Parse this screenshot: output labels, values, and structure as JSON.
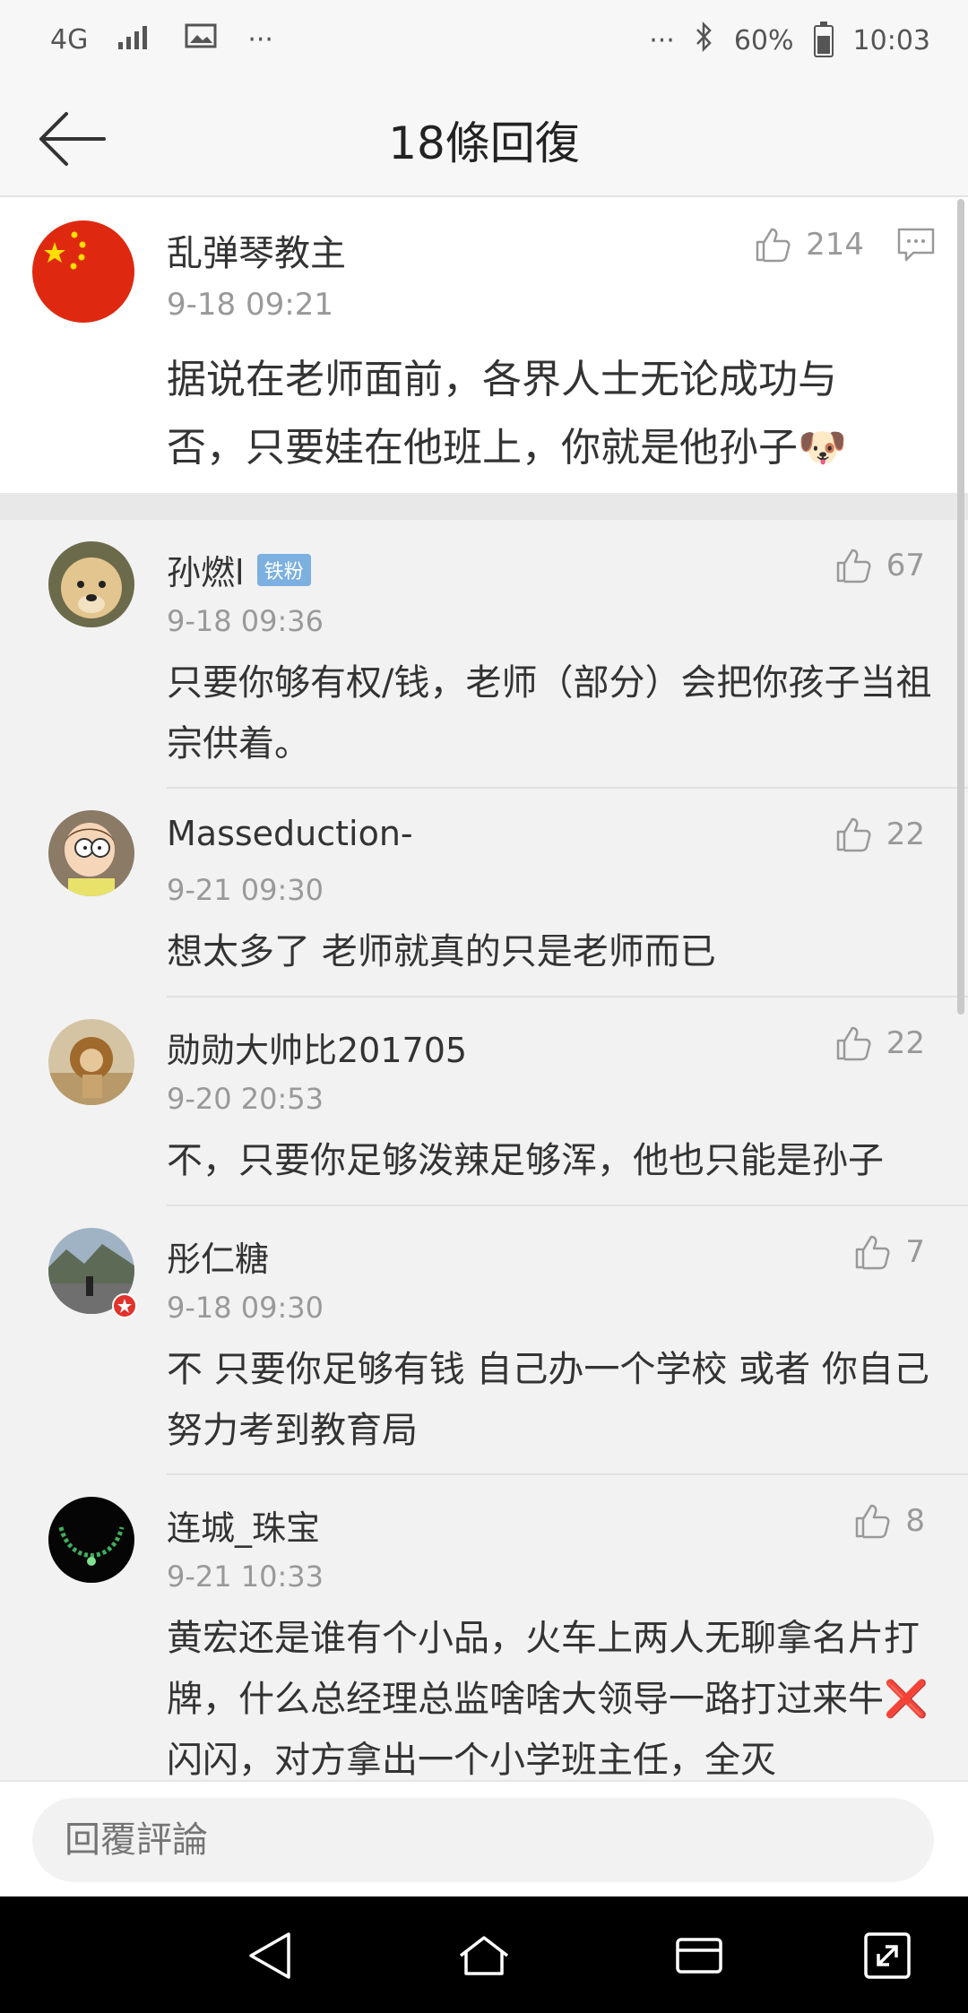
{
  "status_bar": {
    "network": "4G",
    "more_left": "···",
    "more_right": "···",
    "battery_percent": "60%",
    "battery_level": 0.6,
    "time": "10:03"
  },
  "header": {
    "title": "18條回復"
  },
  "root_comment": {
    "author": "乱弹琴教主",
    "time": "9-18 09:21",
    "likes": "214",
    "text": "据说在老师面前，各界人士无论成功与否，只要娃在他班上，你就是他孙子🐶"
  },
  "replies": [
    {
      "author": "孙燃l",
      "badge": "铁粉",
      "time": "9-18 09:36",
      "likes": "67",
      "text": "只要你够有权/钱，老师（部分）会把你孩子当祖宗供着。"
    },
    {
      "author": "Masseduction-",
      "time": "9-21 09:30",
      "likes": "22",
      "text": "想太多了 老师就真的只是老师而已"
    },
    {
      "author": "勋勋大帅比201705",
      "time": "9-20 20:53",
      "likes": "22",
      "text": "不，只要你足够泼辣足够浑，他也只能是孙子"
    },
    {
      "author": "彤仁糖",
      "time": "9-18 09:30",
      "likes": "7",
      "text": "不 只要你足够有钱 自己办一个学校 或者 你自己努力考到教育局"
    },
    {
      "author": "连城_珠宝",
      "time": "9-21 10:33",
      "likes": "8",
      "text": "黄宏还是谁有个小品，火车上两人无聊拿名片打牌，什么总经理总监啥啥大领导一路打过来牛❌闪闪，对方拿出一个小学班主任，全灭"
    }
  ],
  "input": {
    "placeholder": "回覆評論"
  },
  "colors": {
    "background": "#f2f2f2",
    "card": "#ffffff",
    "text": "#333333",
    "muted": "#999999",
    "badge": "#7bb0e0"
  }
}
